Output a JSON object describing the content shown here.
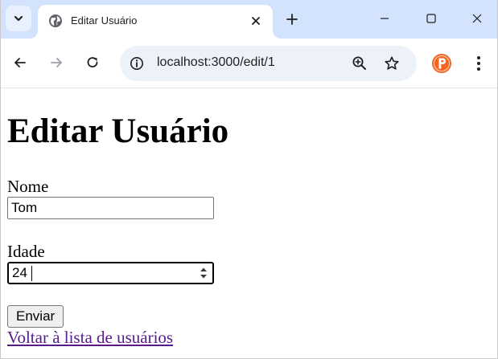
{
  "browser": {
    "tab": {
      "title": "Editar Usuário",
      "favicon": "globe-icon"
    },
    "tabstrip_color": "#d3e3fd",
    "address_bar": {
      "url": "localhost:3000/edit/1",
      "background": "#edf2fa"
    },
    "icons": {
      "tab_search": "chevron-down-icon",
      "close_tab": "close-icon",
      "new_tab": "plus-icon",
      "minimize": "minimize-icon",
      "maximize": "maximize-icon",
      "close_window": "close-icon",
      "back": "arrow-left-icon",
      "forward": "arrow-right-icon",
      "reload": "reload-icon",
      "site_info": "info-icon",
      "zoom": "zoom-in-icon",
      "bookmark": "star-icon",
      "extension": "extension-p-icon",
      "menu": "kebab-menu-icon"
    },
    "extension_color": "#f26522"
  },
  "page": {
    "heading": "Editar Usuário",
    "form": {
      "nome": {
        "label": "Nome",
        "value": "Tom"
      },
      "idade": {
        "label": "Idade",
        "value": "24"
      },
      "submit_label": "Enviar"
    },
    "back_link": "Voltar à lista de usuários",
    "link_color": "#551a8b"
  }
}
